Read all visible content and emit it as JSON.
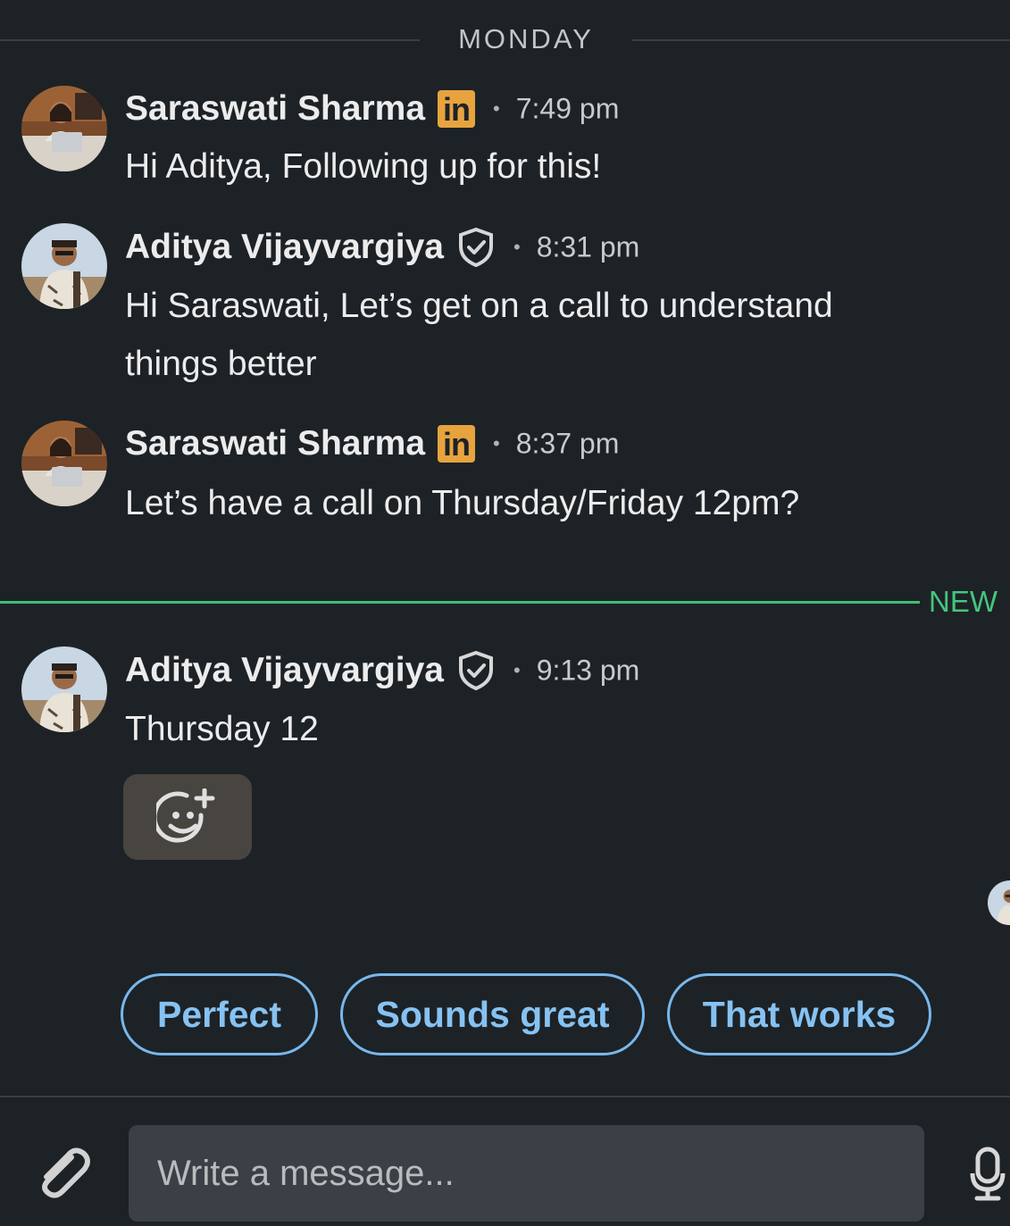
{
  "day_divider": "MONDAY",
  "new_divider": "NEW",
  "messages": [
    {
      "sender": "Saraswati Sharma",
      "badge": "in",
      "time": "7:49 pm",
      "text": "Hi Aditya, Following up for this!"
    },
    {
      "sender": "Aditya Vijayvargiya",
      "badge_icon": "verified-shield-icon",
      "time": "8:31 pm",
      "text": "Hi Saraswati, Let’s get on a call to understand things better"
    },
    {
      "sender": "Saraswati Sharma",
      "badge": "in",
      "time": "8:37 pm",
      "text": "Let’s have a call on Thursday/Friday 12pm?"
    },
    {
      "sender": "Aditya Vijayvargiya",
      "badge_icon": "verified-shield-icon",
      "time": "9:13 pm",
      "text": "Thursday 12"
    }
  ],
  "dot_separator": "•",
  "suggestions": [
    "Perfect",
    "Sounds great",
    "That works"
  ],
  "composer": {
    "placeholder": "Write a message..."
  },
  "colors": {
    "background": "#1d2226",
    "linkedin_badge": "#e7a33e",
    "new_accent": "#3dbf75",
    "suggestion_blue": "#79b7ec"
  }
}
